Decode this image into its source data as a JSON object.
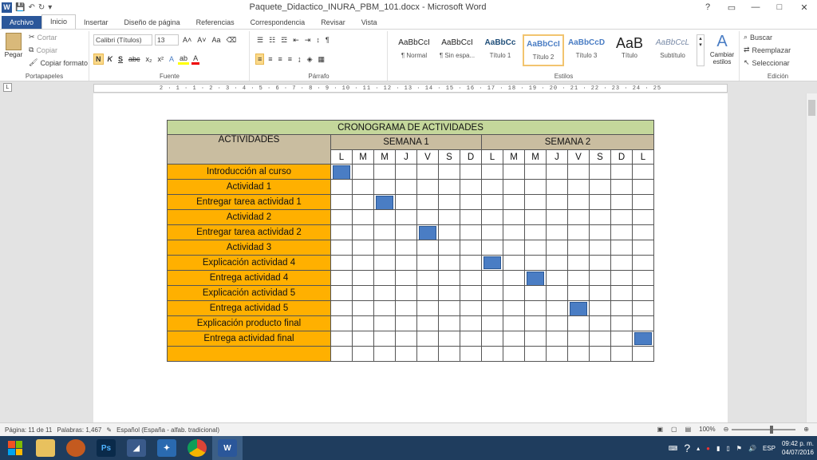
{
  "window": {
    "title": "Paquete_Didactico_INURA_PBM_101.docx - Microsoft Word",
    "controls": [
      "?",
      "▭",
      "—",
      "□",
      "✕"
    ]
  },
  "tabs": [
    {
      "label": "Archivo"
    },
    {
      "label": "Inicio"
    },
    {
      "label": "Insertar"
    },
    {
      "label": "Diseño de página"
    },
    {
      "label": "Referencias"
    },
    {
      "label": "Correspondencia"
    },
    {
      "label": "Revisar"
    },
    {
      "label": "Vista"
    }
  ],
  "ribbon": {
    "clipboard": {
      "paste": "Pegar",
      "cut": "Cortar",
      "copy": "Copiar",
      "format_painter": "Copiar formato",
      "label": "Portapapeles"
    },
    "font": {
      "font_name": "Calibri (Títulos)",
      "font_size": "13",
      "label": "Fuente"
    },
    "paragraph": {
      "label": "Párrafo"
    },
    "styles": {
      "label": "Estilos",
      "items": [
        {
          "preview": "AaBbCcI",
          "label": "¶ Normal"
        },
        {
          "preview": "AaBbCcI",
          "label": "¶ Sin espa..."
        },
        {
          "preview": "AaBbCc",
          "label": "Título 1"
        },
        {
          "preview": "AaBbCcI",
          "label": "Título 2"
        },
        {
          "preview": "AaBbCcD",
          "label": "Título 3"
        },
        {
          "preview": "AaB",
          "label": "Título"
        },
        {
          "preview": "AaBbCcL",
          "label": "Subtítulo"
        }
      ],
      "change_styles": "Cambiar estilos"
    },
    "editing": {
      "find": "Buscar",
      "replace": "Reemplazar",
      "select": "Seleccionar",
      "label": "Edición"
    }
  },
  "ruler": {
    "marks": "2 · 1 · 1 · 2 · 3 · 4 · 5 · 6 · 7 · 8 · 9 · 10 · 11 · 12 · 13 · 14 · 15 · 16 · 17 · 18 · 19 · 20 · 21 · 22 · 23 · 24 · 25"
  },
  "table": {
    "title": "CRONOGRAMA DE ACTIVIDADES",
    "activities_header": "ACTIVIDADES",
    "weeks": [
      "SEMANA 1",
      "SEMANA 2"
    ],
    "days": [
      "L",
      "M",
      "M",
      "J",
      "V",
      "S",
      "D",
      "L",
      "M",
      "M",
      "J",
      "V",
      "S",
      "D",
      "L"
    ],
    "activities": [
      "Introducción al curso",
      "Actividad 1",
      "Entregar tarea actividad 1",
      "Actividad 2",
      "Entregar tarea actividad 2",
      "Actividad 3",
      "Explicación actividad 4",
      "Entrega actividad 4",
      "Explicación actividad 5",
      "Entrega actividad 5",
      "Explicación producto final",
      "Entrega actividad final",
      ""
    ],
    "blocks": [
      {
        "row": 0,
        "col": 0,
        "span": 2
      },
      {
        "row": 2,
        "col": 2,
        "span": 2
      },
      {
        "row": 4,
        "col": 4,
        "span": 2
      },
      {
        "row": 6,
        "col": 7,
        "span": 1
      },
      {
        "row": 7,
        "col": 9,
        "span": 2
      },
      {
        "row": 9,
        "col": 11,
        "span": 2
      },
      {
        "row": 11,
        "col": 14,
        "span": 1
      }
    ],
    "colors": {
      "title_bg": "#c4d79b",
      "header_bg": "#c9bda0",
      "activity_bg": "#ffb000",
      "block": "#4a7dc4"
    }
  },
  "status": {
    "page": "Página: 11 de 11",
    "words": "Palabras: 1,467",
    "language": "Español (España - alfab. tradicional)",
    "zoom": "100%",
    "zoom_level": 1.0
  },
  "taskbar": {
    "apps": [
      "explorer",
      "firefox",
      "photoshop",
      "app4",
      "app5",
      "chrome",
      "word"
    ],
    "lang": "ESP",
    "time": "09:42 p. m.",
    "date": "04/07/2016"
  }
}
